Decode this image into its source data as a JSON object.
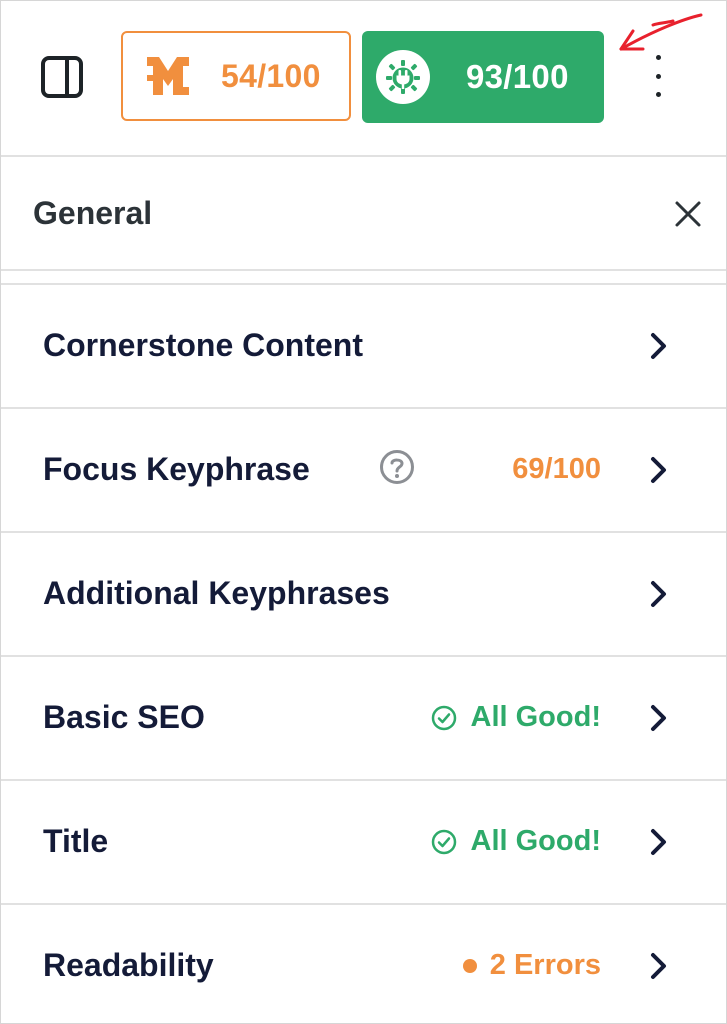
{
  "toolbar": {
    "aioseo_score": "54/100",
    "seo_score": "93/100",
    "colors": {
      "aioseo_accent": "#f18f3e",
      "seo_green": "#2eaa6a",
      "annotation": "#e8212d"
    },
    "icons": [
      "sidebar-toggle-icon",
      "aioseo-logo-icon",
      "plugin-badge-icon",
      "more-vertical-icon",
      "annotation-arrow"
    ]
  },
  "panel": {
    "title": "General",
    "close_icon": "close-icon"
  },
  "rows": [
    {
      "label": "Cornerstone Content",
      "status": ""
    },
    {
      "label": "Focus Keyphrase",
      "status": "69/100",
      "status_type": "score",
      "help_icon": "help-icon"
    },
    {
      "label": "Additional Keyphrases",
      "status": ""
    },
    {
      "label": "Basic SEO",
      "status": "All Good!",
      "status_type": "good"
    },
    {
      "label": "Title",
      "status": "All Good!",
      "status_type": "good"
    },
    {
      "label": "Readability",
      "status": "2 Errors",
      "status_type": "errors"
    }
  ]
}
